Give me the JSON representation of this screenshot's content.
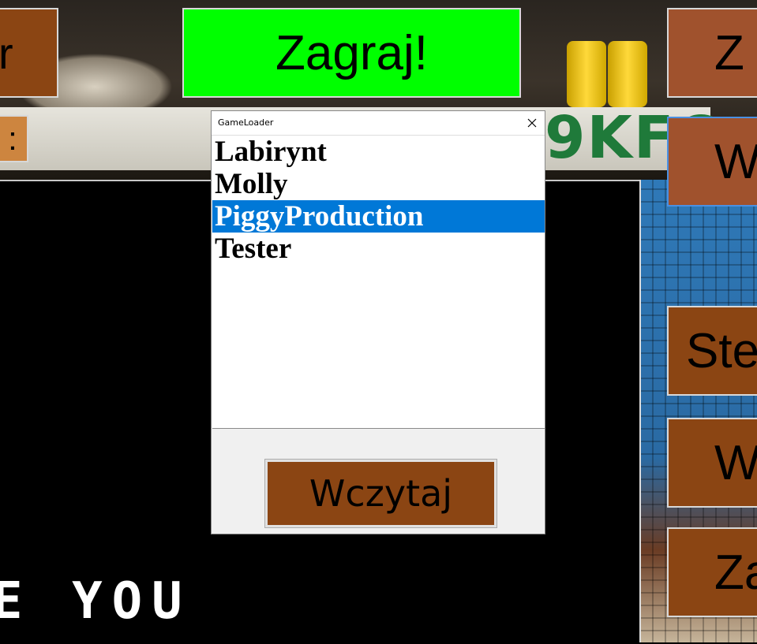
{
  "background": {
    "pixel_text": "E YOU",
    "shelf_text": "9KFC"
  },
  "menu": {
    "play_label": "Zagraj!",
    "left_top_label": "r",
    "left_small_label": ":",
    "right_buttons": [
      "Z",
      "W",
      "Ste",
      "W",
      "Za"
    ]
  },
  "dialog": {
    "title": "GameLoader",
    "items": [
      "Labirynt",
      "Molly",
      "PiggyProduction",
      "Tester"
    ],
    "selected_index": 2,
    "load_label": "Wczytaj"
  },
  "colors": {
    "play": "#00ff00",
    "menu_button": "#a0522d",
    "load_button": "#8b4513",
    "selection": "#0078d7"
  }
}
